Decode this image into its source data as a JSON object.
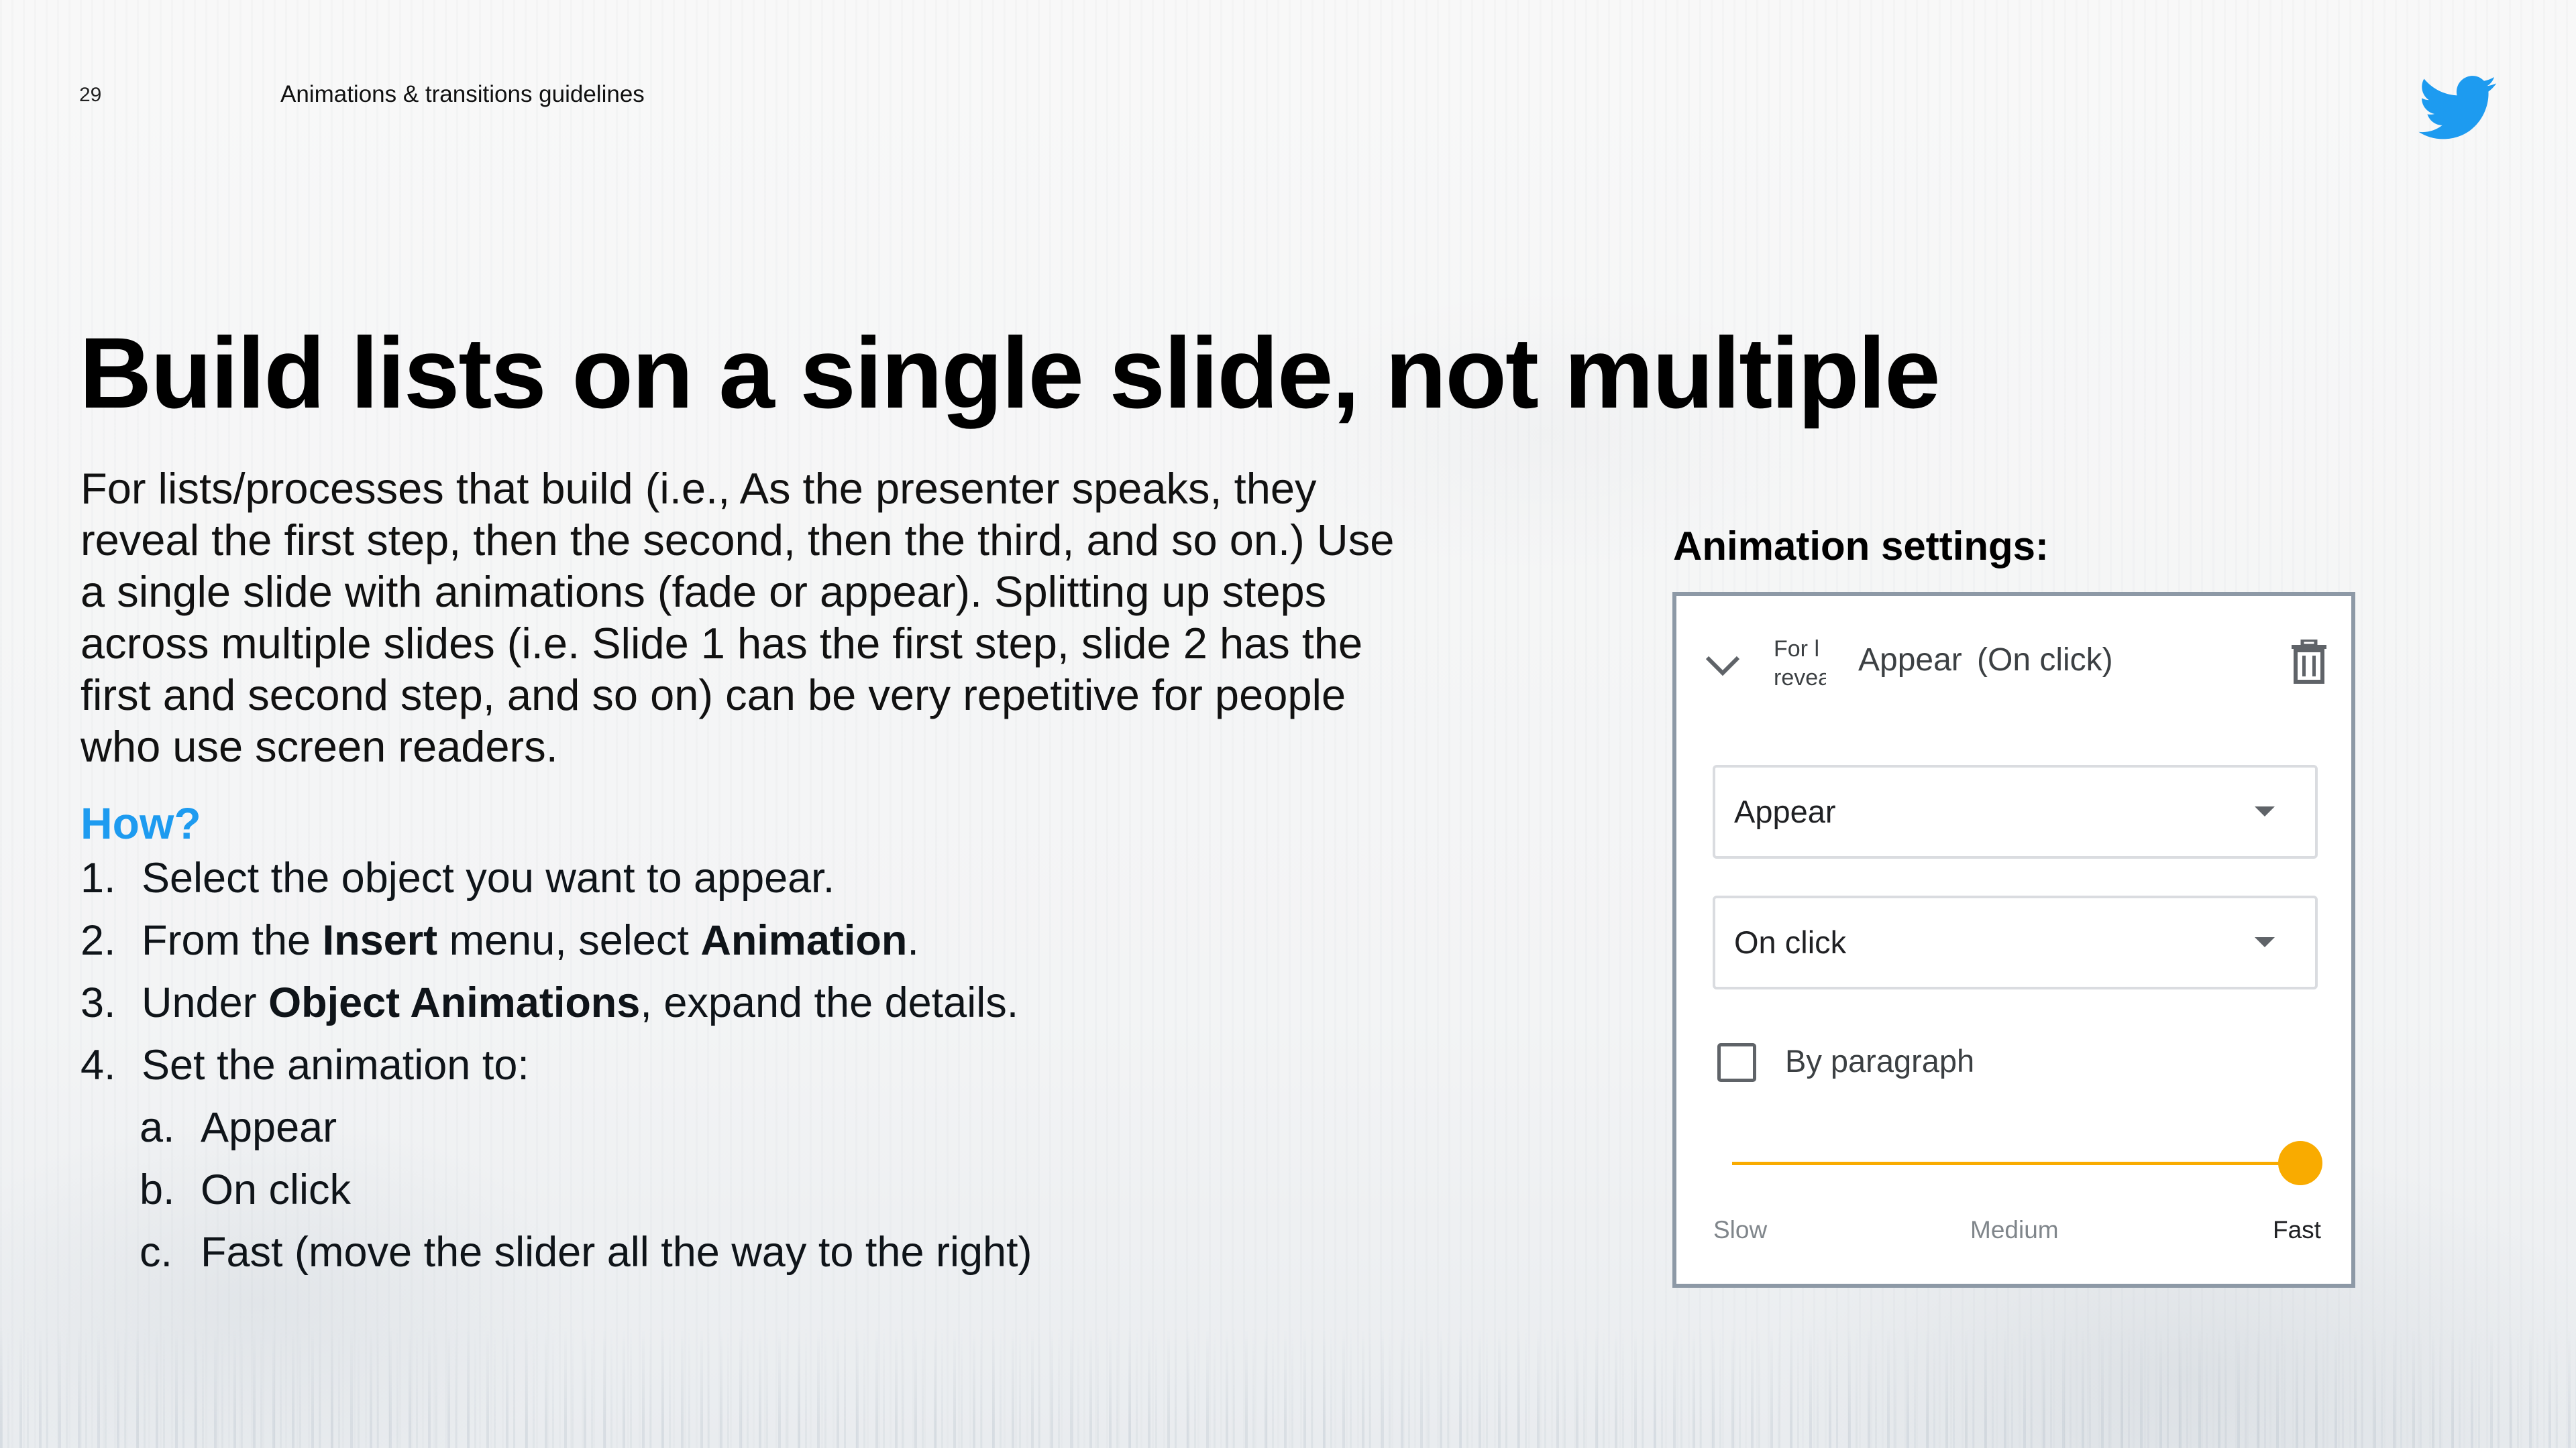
{
  "header": {
    "page_number": "29",
    "title": "Animations & transitions guidelines",
    "logo_icon": "twitter-bird-icon",
    "brand_color": "#1d9bf0"
  },
  "slide": {
    "title": "Build lists on a single slide, not multiple",
    "body": "For lists/processes that build (i.e., As the presenter speaks, they reveal the first step, then the second, then the third, and so on.) Use a single slide with animations (fade or appear). Splitting up steps across multiple slides (i.e. Slide 1 has the first step, slide 2 has the first and second step, and so on) can be very repetitive for people who use screen readers.",
    "how_heading": "How?",
    "steps": [
      {
        "number": "1.",
        "text_parts": [
          "Select the object you want to appear."
        ]
      },
      {
        "number": "2.",
        "text_parts": [
          "From the ",
          "Insert",
          " menu, select ",
          "Animation",
          "."
        ]
      },
      {
        "number": "3.",
        "text_parts": [
          "Under ",
          "Object Animations",
          ", expand the details."
        ]
      },
      {
        "number": "4.",
        "text_parts": [
          "Set the animation to:"
        ]
      }
    ],
    "substeps": [
      {
        "letter": "a.",
        "text": "Appear"
      },
      {
        "letter": "b.",
        "text": "On click"
      },
      {
        "letter": "c.",
        "text": "Fast (move the slider all the way to the right)"
      }
    ]
  },
  "animation_settings": {
    "heading": "Animation settings:",
    "summary": {
      "truncated_line1": "For l",
      "truncated_line2": "revea",
      "effect": "Appear",
      "trigger": "(On click)"
    },
    "effect_select": {
      "value": "Appear"
    },
    "trigger_select": {
      "value": "On click"
    },
    "by_paragraph": {
      "label": "By paragraph",
      "checked": false
    },
    "speed": {
      "labels": {
        "slow": "Slow",
        "medium": "Medium",
        "fast": "Fast"
      },
      "selected": "Fast",
      "level": 1.0
    },
    "accent_color": "#f9ab00"
  }
}
